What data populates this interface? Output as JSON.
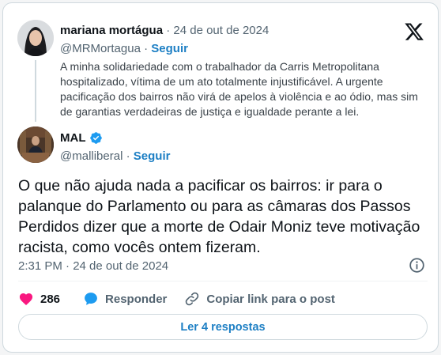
{
  "quoted_tweet": {
    "author_name": "mariana mortágua",
    "separator": "·",
    "date": "24 de out de 2024",
    "handle": "@MRMortagua",
    "follow_label": "Seguir",
    "text": "A minha solidariedade com o trabalhador da Carris Metropolitana hospitalizado, vítima de um ato totalmente injustificável. A urgente pacificação dos bairros não virá de apelos à violência e ao ódio, mas sim de garantias verdadeiras de justiça e igualdade perante a lei."
  },
  "main_tweet": {
    "author_name": "MAL",
    "handle": "@malliberal",
    "separator": "·",
    "follow_label": "Seguir",
    "verified": true,
    "text": "O que não ajuda nada a pacificar os bairros: ir para o palanque do Parlamento ou para as câmaras dos Passos Perdidos dizer que a morte de Odair Moniz teve motivação racista, como vocês ontem fizeram.",
    "timestamp": "2:31 PM · 24 de out de 2024"
  },
  "actions": {
    "like_count": "286",
    "reply_label": "Responder",
    "copy_link_label": "Copiar link para o post"
  },
  "read_replies_label": "Ler 4 respostas",
  "colors": {
    "accent": "#1d9bf0",
    "like": "#f91880",
    "text": "#0f1419",
    "muted": "#536471"
  },
  "icons": {
    "brand": "x-logo-icon",
    "verified": "verified-badge-icon",
    "info": "info-icon",
    "like": "heart-icon",
    "reply": "reply-bubble-icon",
    "copy_link": "link-icon"
  }
}
